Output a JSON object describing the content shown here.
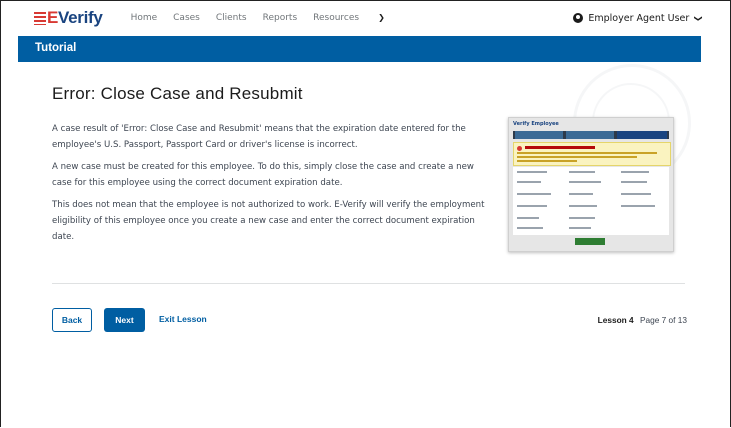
{
  "header": {
    "logo": {
      "prefix": "E",
      "text": "Verify"
    },
    "nav": [
      "Home",
      "Cases",
      "Clients",
      "Reports",
      "Resources"
    ],
    "user_label": "Employer Agent User"
  },
  "banner": {
    "title": "Tutorial"
  },
  "main": {
    "title": "Error: Close Case and Resubmit",
    "paragraphs": [
      "A case result of 'Error: Close Case and Resubmit' means that the expiration date entered for the employee's U.S. Passport, Passport Card or driver's license is incorrect.",
      "A new case must be created for this employee. To do this, simply close the case and create a new case for this employee using the correct document expiration date.",
      "This does not mean that the employee is not authorized to work. E-Verify will verify the employment eligibility of this employee once you create a new case and enter the correct document expiration date."
    ],
    "thumbnail": {
      "heading": "Verify Employee"
    }
  },
  "footer": {
    "back_label": "Back",
    "next_label": "Next",
    "exit_label": "Exit Lesson",
    "lesson_label": "Lesson 4",
    "page_label": "Page 7 of 13"
  },
  "colors": {
    "primary": "#005ea2",
    "brand_red": "#d83933",
    "text": "#3d4551"
  },
  "icons": {
    "user": "user-circle-icon",
    "dropdown": "chevron-down-icon",
    "seal": "dhs-seal-icon"
  }
}
